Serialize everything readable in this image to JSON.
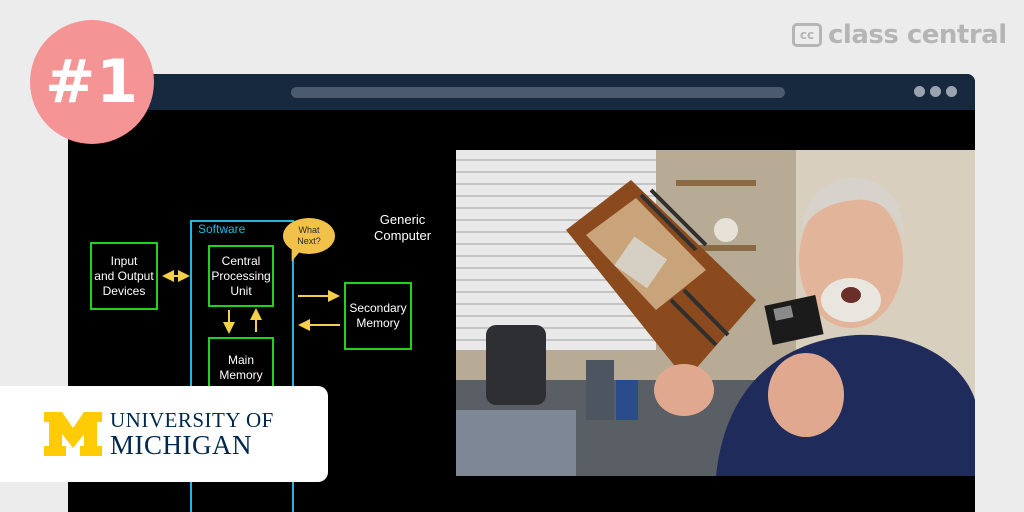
{
  "rank": {
    "label": "#1"
  },
  "brand": {
    "icon_text": "cc",
    "name": "class central"
  },
  "diagram": {
    "software_label": "Software",
    "generic_label": "Generic\nComputer",
    "bubble_text": "What\nNext?",
    "boxes": {
      "io": "Input\nand Output\nDevices",
      "cpu": "Central\nProcessing\nUnit",
      "secondary": "Secondary\nMemory",
      "main": "Main\nMemory"
    },
    "colors": {
      "box_border": "#1fd21f",
      "software_border": "#1fb8e0",
      "arrow": "#f2d04a"
    }
  },
  "university": {
    "logo_letter": "M",
    "line1": "UNIVERSITY OF",
    "line2": "MICHIGAN",
    "colors": {
      "maize": "#ffcb05",
      "blue": "#00274c"
    }
  },
  "colors": {
    "window_bar": "#17293e",
    "badge": "#f59494",
    "background": "#ececec"
  }
}
